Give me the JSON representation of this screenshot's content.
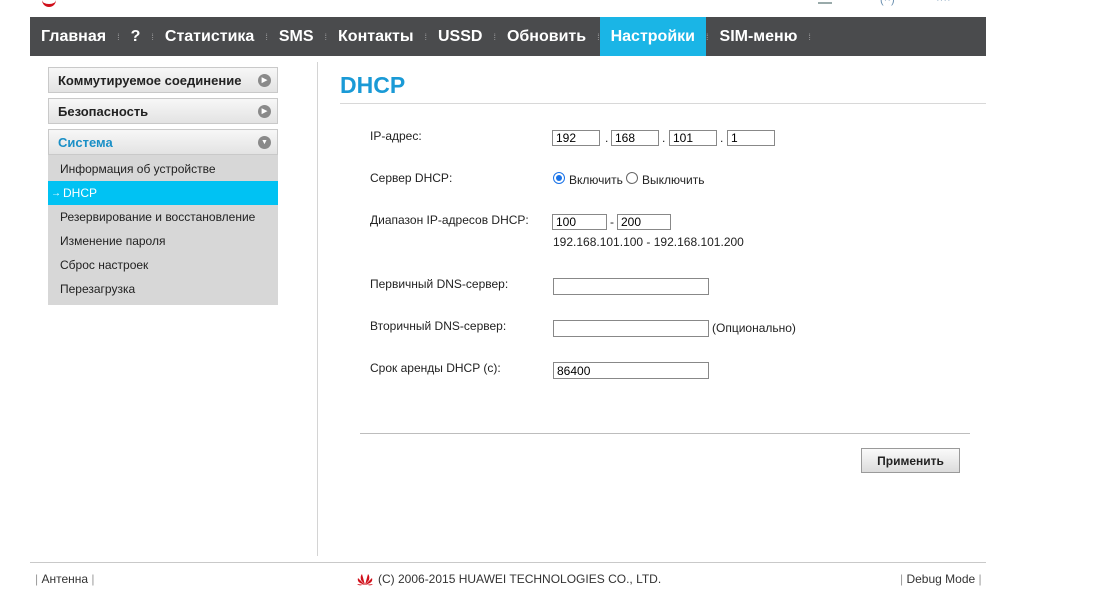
{
  "nav": {
    "items": [
      {
        "label": "Главная"
      },
      {
        "label": "?"
      },
      {
        "label": "Статистика"
      },
      {
        "label": "SMS"
      },
      {
        "label": "Контакты"
      },
      {
        "label": "USSD"
      },
      {
        "label": "Обновить"
      },
      {
        "label": "Настройки",
        "active": true
      },
      {
        "label": "SIM-меню"
      }
    ],
    "active_color": "#1ab5e6",
    "bar_color": "#4a4b4d"
  },
  "sidebar": {
    "sections": [
      {
        "label": "Коммутируемое соединение"
      },
      {
        "label": "Безопасность"
      },
      {
        "label": "Система",
        "expanded": true
      }
    ],
    "system_items": [
      {
        "label": "Информация об устройстве"
      },
      {
        "label": "DHCP",
        "active": true
      },
      {
        "label": "Резервирование и восстановление"
      },
      {
        "label": "Изменение пароля"
      },
      {
        "label": "Сброс настроек"
      },
      {
        "label": "Перезагрузка"
      }
    ],
    "active_arrow": "→"
  },
  "page": {
    "title": "DHCP",
    "accent": "#1a9ad6"
  },
  "form": {
    "ip_label": "IP-адрес:",
    "ip": [
      "192",
      "168",
      "101",
      "1"
    ],
    "dhcp_server_label": "Сервер DHCP:",
    "enable_label": "Включить",
    "disable_label": "Выключить",
    "dhcp_enabled": true,
    "range_label": "Диапазон IP-адресов DHCP:",
    "range_start": "100",
    "range_end": "200",
    "range_text": "192.168.101.100 - 192.168.101.200",
    "primary_dns_label": "Первичный DNS-сервер:",
    "primary_dns": "",
    "secondary_dns_label": "Вторичный DNS-сервер:",
    "secondary_dns": "",
    "optional_label": "(Опционально)",
    "lease_label": "Срок аренды DHCP (с):",
    "lease": "86400",
    "apply_label": "Применить"
  },
  "footer": {
    "left": "Антенна",
    "copyright": "(C) 2006-2015 HUAWEI TECHNOLOGIES CO., LTD.",
    "right": "Debug Mode"
  }
}
